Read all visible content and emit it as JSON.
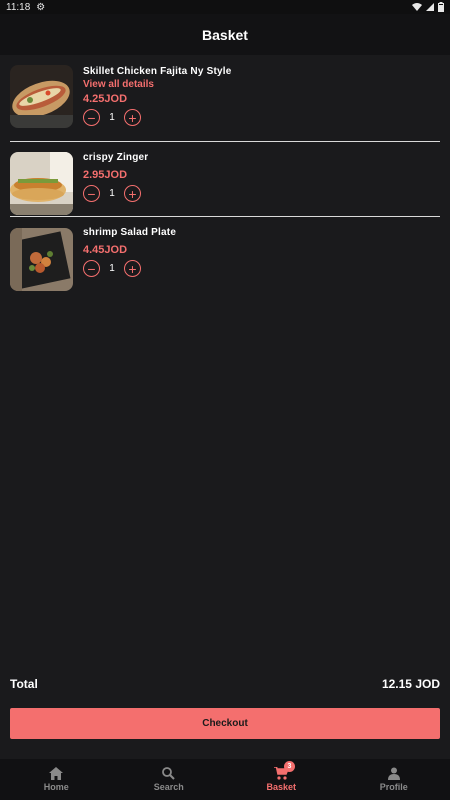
{
  "status_bar": {
    "time": "11:18"
  },
  "header": {
    "title": "Basket"
  },
  "items": [
    {
      "name": "Skillet Chicken Fajita Ny Style",
      "details": "View all details",
      "price": "4.25JOD",
      "qty": "1"
    },
    {
      "name": "crispy Zinger",
      "price": "2.95JOD",
      "qty": "1"
    },
    {
      "name": "shrimp Salad Plate",
      "price": "4.45JOD",
      "qty": "1"
    }
  ],
  "summary": {
    "total_label": "Total",
    "total_value": "12.15 JOD",
    "checkout_label": "Checkout"
  },
  "nav": {
    "items": [
      {
        "label": "Home",
        "icon": "home-icon"
      },
      {
        "label": "Search",
        "icon": "search-icon"
      },
      {
        "label": "Basket",
        "icon": "cart-icon",
        "badge": "3"
      },
      {
        "label": "Profile",
        "icon": "person-icon"
      }
    ],
    "active": "Basket"
  },
  "colors": {
    "accent": "#f46f6e",
    "background": "#1a1a1c",
    "header": "#121214"
  }
}
